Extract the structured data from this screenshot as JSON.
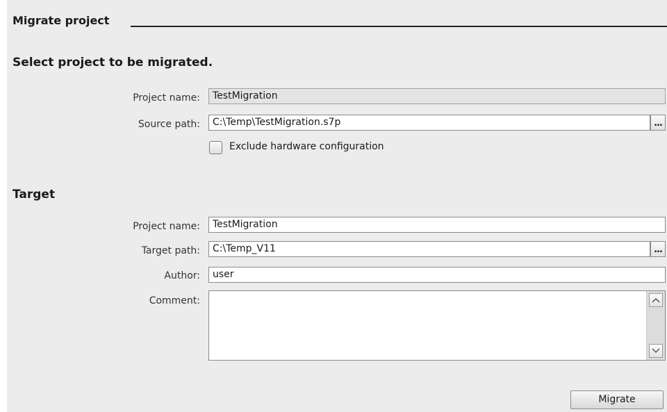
{
  "header": {
    "title": "Migrate project"
  },
  "source": {
    "heading": "Select project to be migrated.",
    "project_name_label": "Project name:",
    "project_name_value": "TestMigration",
    "source_path_label": "Source path:",
    "source_path_value": "C:\\Temp\\TestMigration.s7p",
    "browse_label": "...",
    "exclude_hw_label": "Exclude hardware configuration",
    "exclude_hw_checked": false
  },
  "target": {
    "heading": "Target",
    "project_name_label": "Project name:",
    "project_name_value": "TestMigration",
    "target_path_label": "Target path:",
    "target_path_value": "C:\\Temp_V11",
    "browse_label": "...",
    "author_label": "Author:",
    "author_value": "user",
    "comment_label": "Comment:",
    "comment_value": ""
  },
  "actions": {
    "migrate_label": "Migrate"
  },
  "icons": {
    "scroll_up": "chevron-up-icon",
    "scroll_down": "chevron-down-icon"
  }
}
